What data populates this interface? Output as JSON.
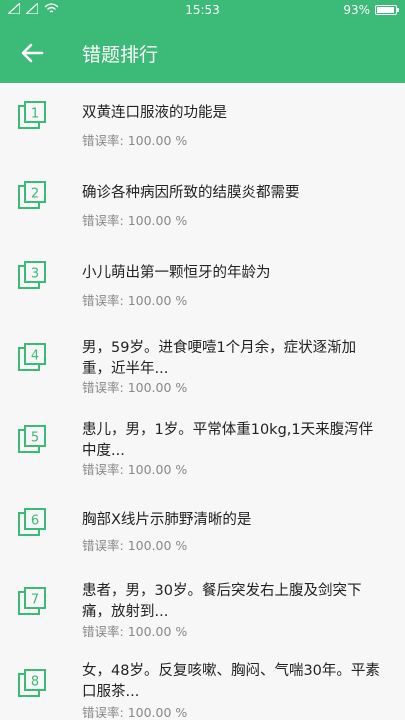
{
  "statusbar": {
    "time": "15:53",
    "battery": "93%"
  },
  "header": {
    "title": "错题排行"
  },
  "items": [
    {
      "num": "1",
      "question": "双黄连口服液的功能是",
      "error_label": "错误率:",
      "error_value": "100.00 %"
    },
    {
      "num": "2",
      "question": "确诊各种病因所致的结膜炎都需要",
      "error_label": "错误率:",
      "error_value": "100.00 %"
    },
    {
      "num": "3",
      "question": "小儿萌出第一颗恒牙的年龄为",
      "error_label": "错误率:",
      "error_value": "100.00 %"
    },
    {
      "num": "4",
      "question": "男，59岁。进食哽噎1个月余，症状逐渐加重，近半年...",
      "error_label": "错误率:",
      "error_value": "100.00 %"
    },
    {
      "num": "5",
      "question": "患儿，男，1岁。平常体重10kg,1天来腹泻伴中度...",
      "error_label": "错误率:",
      "error_value": "100.00 %"
    },
    {
      "num": "6",
      "question": "胸部X线片示肺野清晰的是",
      "error_label": "错误率:",
      "error_value": "100.00 %"
    },
    {
      "num": "7",
      "question": "患者，男，30岁。餐后突发右上腹及剑突下痛，放射到...",
      "error_label": "错误率:",
      "error_value": "100.00 %"
    },
    {
      "num": "8",
      "question": "女，48岁。反复咳嗽、胸闷、气喘30年。平素口服茶...",
      "error_label": "错误率:",
      "error_value": "100.00 %"
    }
  ],
  "colors": {
    "accent": "#3cba77",
    "icon": "#3cba77"
  }
}
